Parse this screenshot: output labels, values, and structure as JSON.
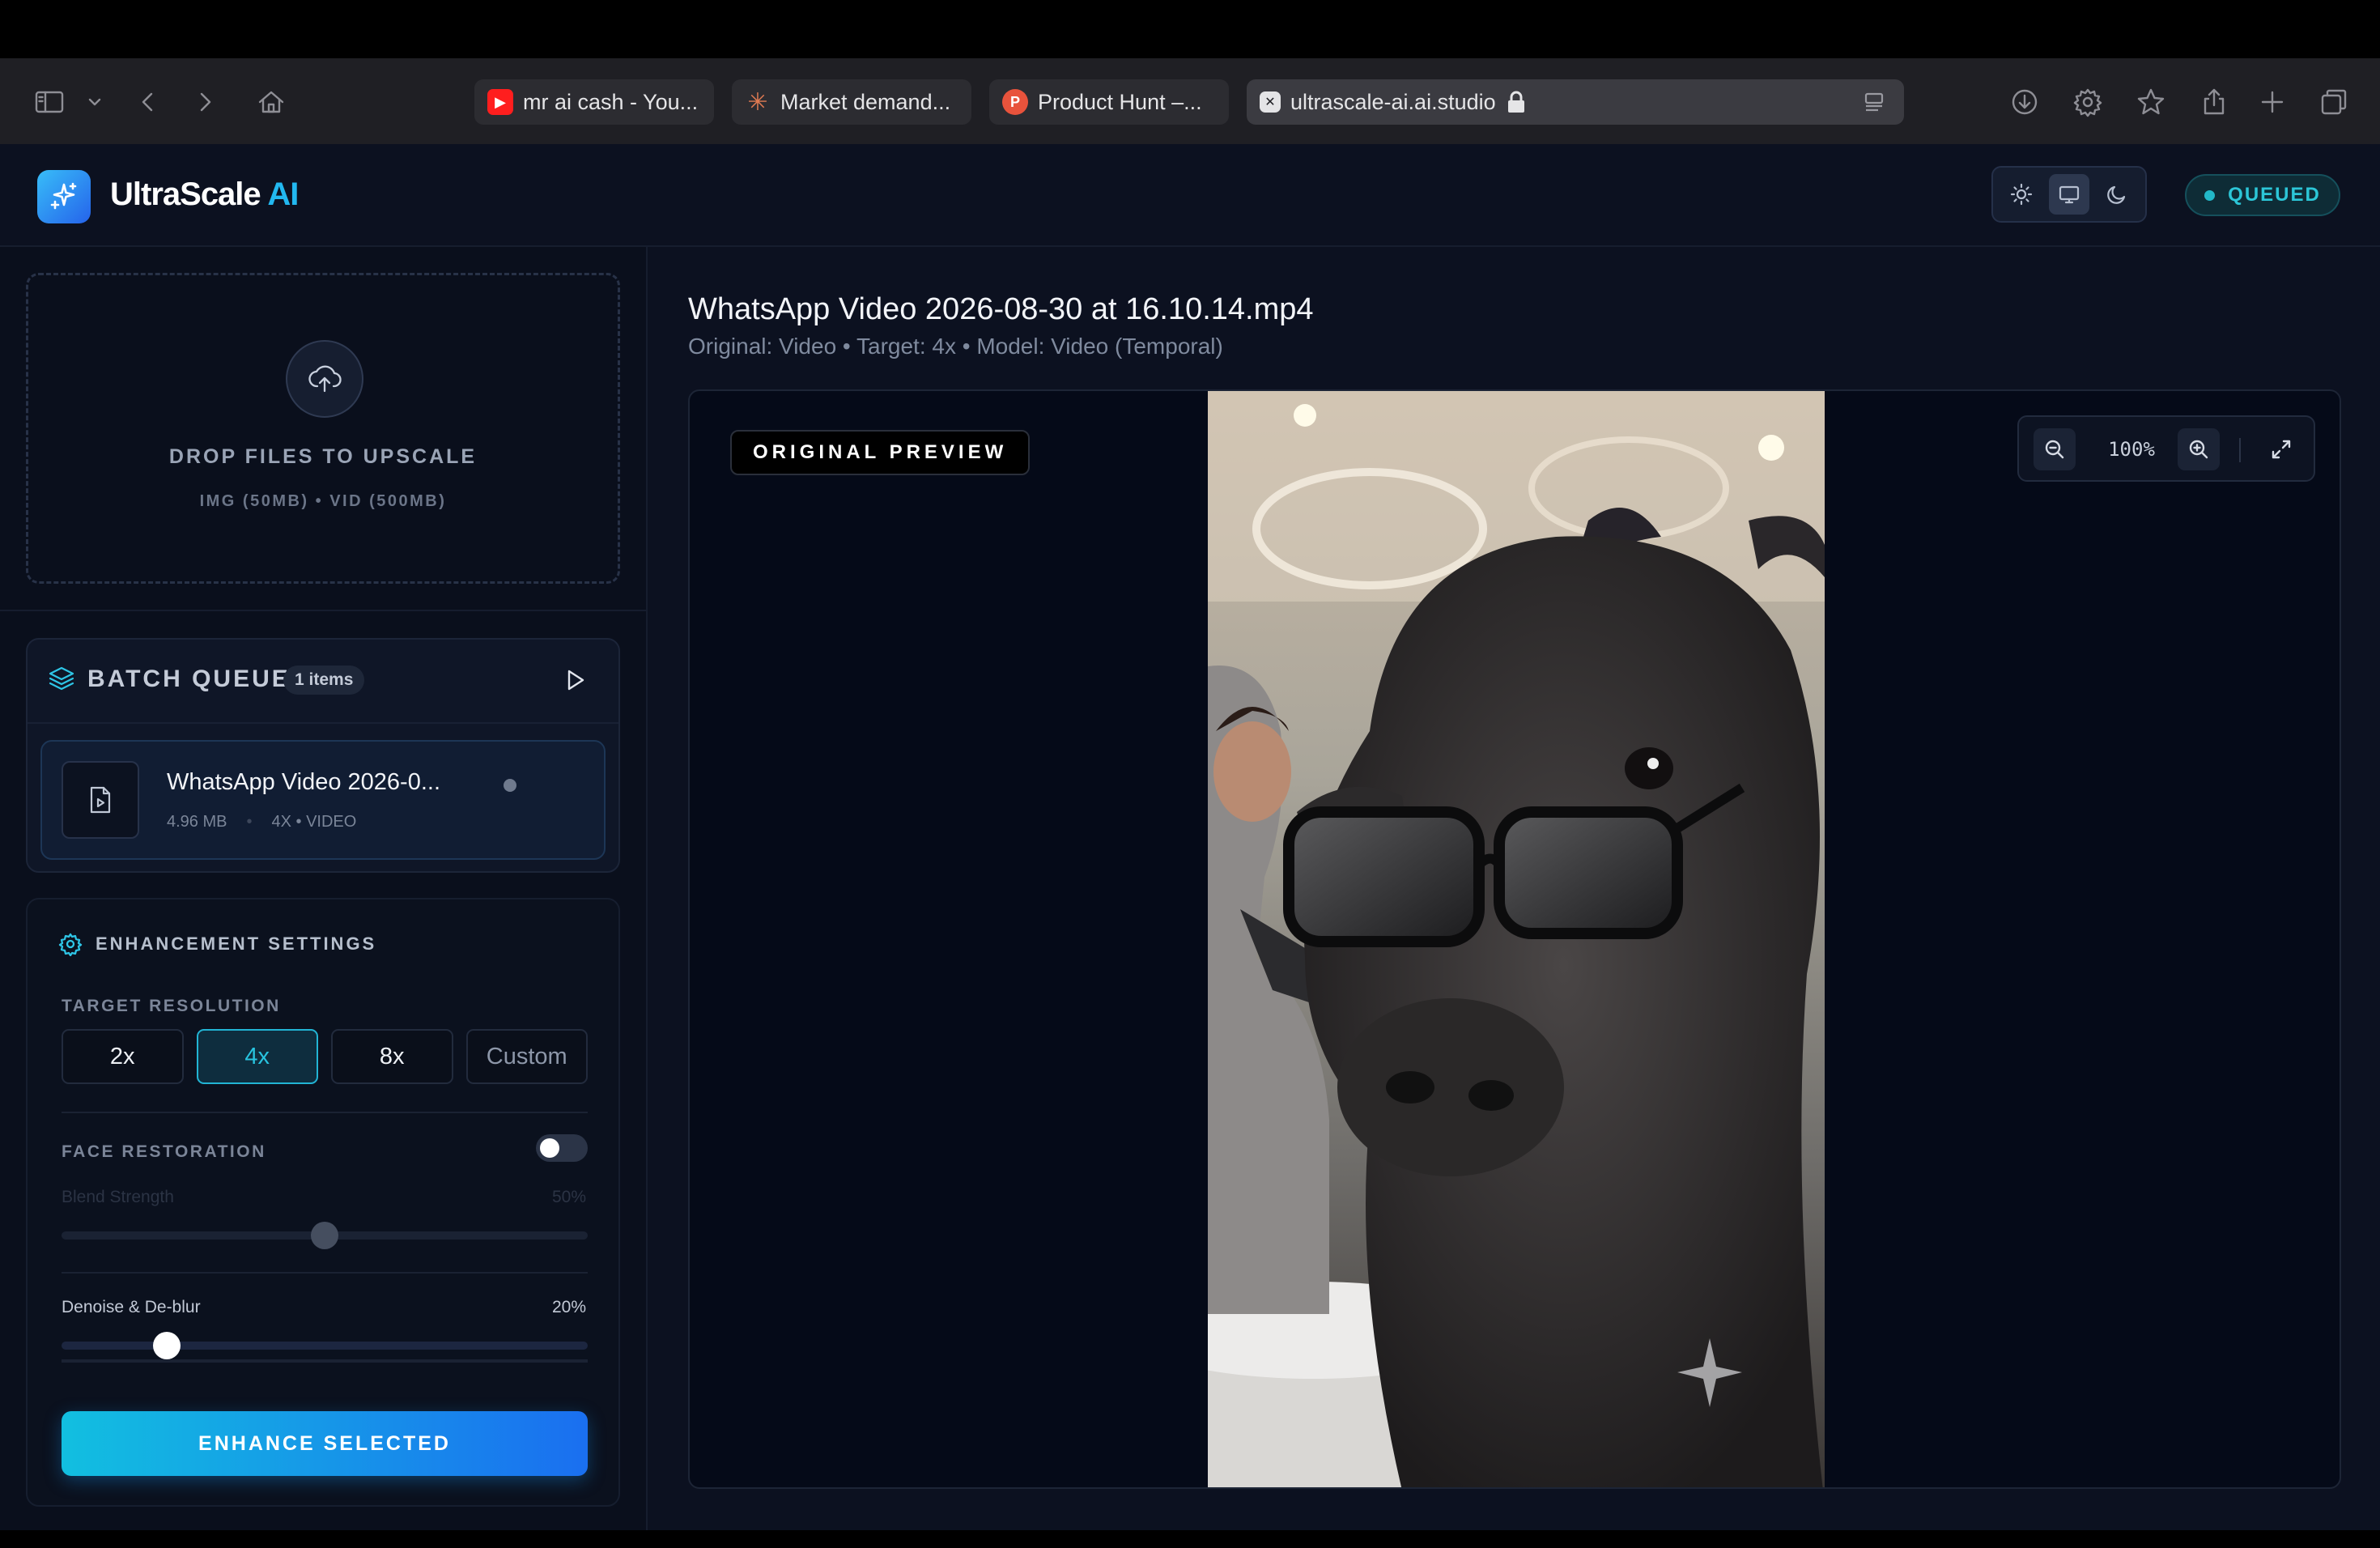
{
  "browser": {
    "tabs": [
      {
        "label": "mr ai cash - You...",
        "icon": "youtube-icon"
      },
      {
        "label": "Market demand...",
        "icon": "claude-icon"
      },
      {
        "label": "Product Hunt –...",
        "icon": "producthunt-icon"
      },
      {
        "label": "ultrascale-ai.ai.studio",
        "icon": "aistudio-icon"
      }
    ]
  },
  "app": {
    "brand": "UltraScale",
    "brand_accent": "AI",
    "status": "QUEUED",
    "accent_color": "#22b8f0"
  },
  "dropzone": {
    "title": "DROP FILES TO UPSCALE",
    "subtitle": "IMG (50MB) • VID (500MB)"
  },
  "queue": {
    "title": "BATCH QUEUE",
    "count": "1 items",
    "items": [
      {
        "name": "WhatsApp Video 2026-0...",
        "size": "4.96 MB",
        "details": "4X • VIDEO"
      }
    ]
  },
  "settings": {
    "title": "ENHANCEMENT SETTINGS",
    "target_label": "TARGET RESOLUTION",
    "resolutions": [
      "2x",
      "4x",
      "8x",
      "Custom"
    ],
    "selected_resolution": "4x",
    "face_label": "FACE RESTORATION",
    "face_enabled": false,
    "blend_label": "Blend Strength",
    "blend_value": "50%",
    "blend_level": 0.5,
    "denoise_label": "Denoise & De-blur",
    "denoise_value": "20%",
    "denoise_level": 0.2,
    "enhance_button": "ENHANCE SELECTED"
  },
  "preview": {
    "filename": "WhatsApp Video 2026-08-30 at 16.10.14.mp4",
    "meta": "Original: Video • Target: 4x • Model: Video (Temporal)",
    "badge": "ORIGINAL PREVIEW",
    "zoom": "100%"
  }
}
